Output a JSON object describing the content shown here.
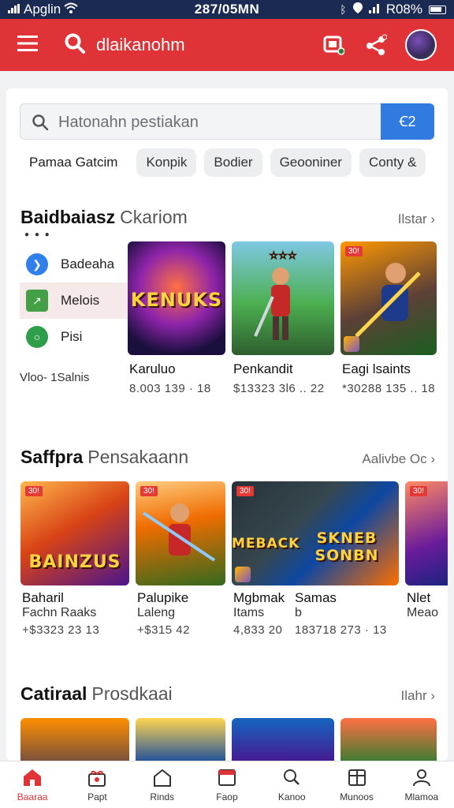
{
  "status_bar": {
    "left_text": "Apglin",
    "time": "287/05MN",
    "battery_text": "R08%"
  },
  "app_bar": {
    "title": "dlaikanohm"
  },
  "search": {
    "placeholder": "Hatonahn pestiakan",
    "button_label": "Ꞓ2"
  },
  "filters": {
    "lead": "Pamaa Gatcim",
    "chips": [
      "Konpik",
      "Bodier",
      "Geooniner",
      "Conty &"
    ]
  },
  "section1": {
    "title": "Baidbaiasz",
    "subtitle": "Ckariom",
    "more": "Ilstar ›",
    "categories": [
      {
        "label": "Badeaha",
        "color": "#2f80ed"
      },
      {
        "label": "Melois",
        "color": "#43a047"
      },
      {
        "label": "Pisi",
        "color": "#2e9e4a"
      }
    ],
    "category_footer": "Vloo- 1Salnis",
    "tiles": [
      {
        "name": "Karuluo",
        "stats": "8.003 139 · 18",
        "art": "KENUKS",
        "badge": ""
      },
      {
        "name": "Penkandit",
        "stats": "$13323 3l6 .. 22",
        "art": "",
        "badge": ""
      },
      {
        "name": "Eagi lsaints",
        "stats": "*30288 135 .. 18",
        "art": "",
        "badge": "30!"
      }
    ]
  },
  "section2": {
    "title": "Saffpra",
    "subtitle": "Pensakaann",
    "more": "Aalivbe Oc ›",
    "tiles": [
      {
        "name": "Baharil",
        "sub": "Fachn Raaks",
        "stats": "+$3323 23   13",
        "art": "BAINZUS",
        "badge": "30!"
      },
      {
        "name": "Palupike",
        "sub": "Laleng",
        "stats": "+$315 42",
        "art": "",
        "badge": "30!"
      },
      {
        "name": "Mgbmak",
        "sub": "Itams",
        "stats": "4,833 20",
        "art": "MEBACK",
        "badge": "30!"
      },
      {
        "name": "Samas",
        "sub": "b",
        "stats": "183718 273 · 13",
        "art": "SKNEB SONBN",
        "badge": ""
      },
      {
        "name": "Nlet",
        "sub": "Meao",
        "stats": "",
        "art": "",
        "badge": "30!"
      }
    ]
  },
  "section3": {
    "title": "Catiraal",
    "subtitle": "Prosdkaai",
    "more": "Ilahr ›"
  },
  "bottom_nav": [
    {
      "label": "Baaraa",
      "icon": "home-icon"
    },
    {
      "label": "Papt",
      "icon": "gift-icon"
    },
    {
      "label": "Rinds",
      "icon": "house-icon"
    },
    {
      "label": "Faop",
      "icon": "store-icon"
    },
    {
      "label": "Kanoo",
      "icon": "search-icon"
    },
    {
      "label": "Munoos",
      "icon": "grid-icon"
    },
    {
      "label": "Mlamoa",
      "icon": "profile-icon"
    }
  ]
}
